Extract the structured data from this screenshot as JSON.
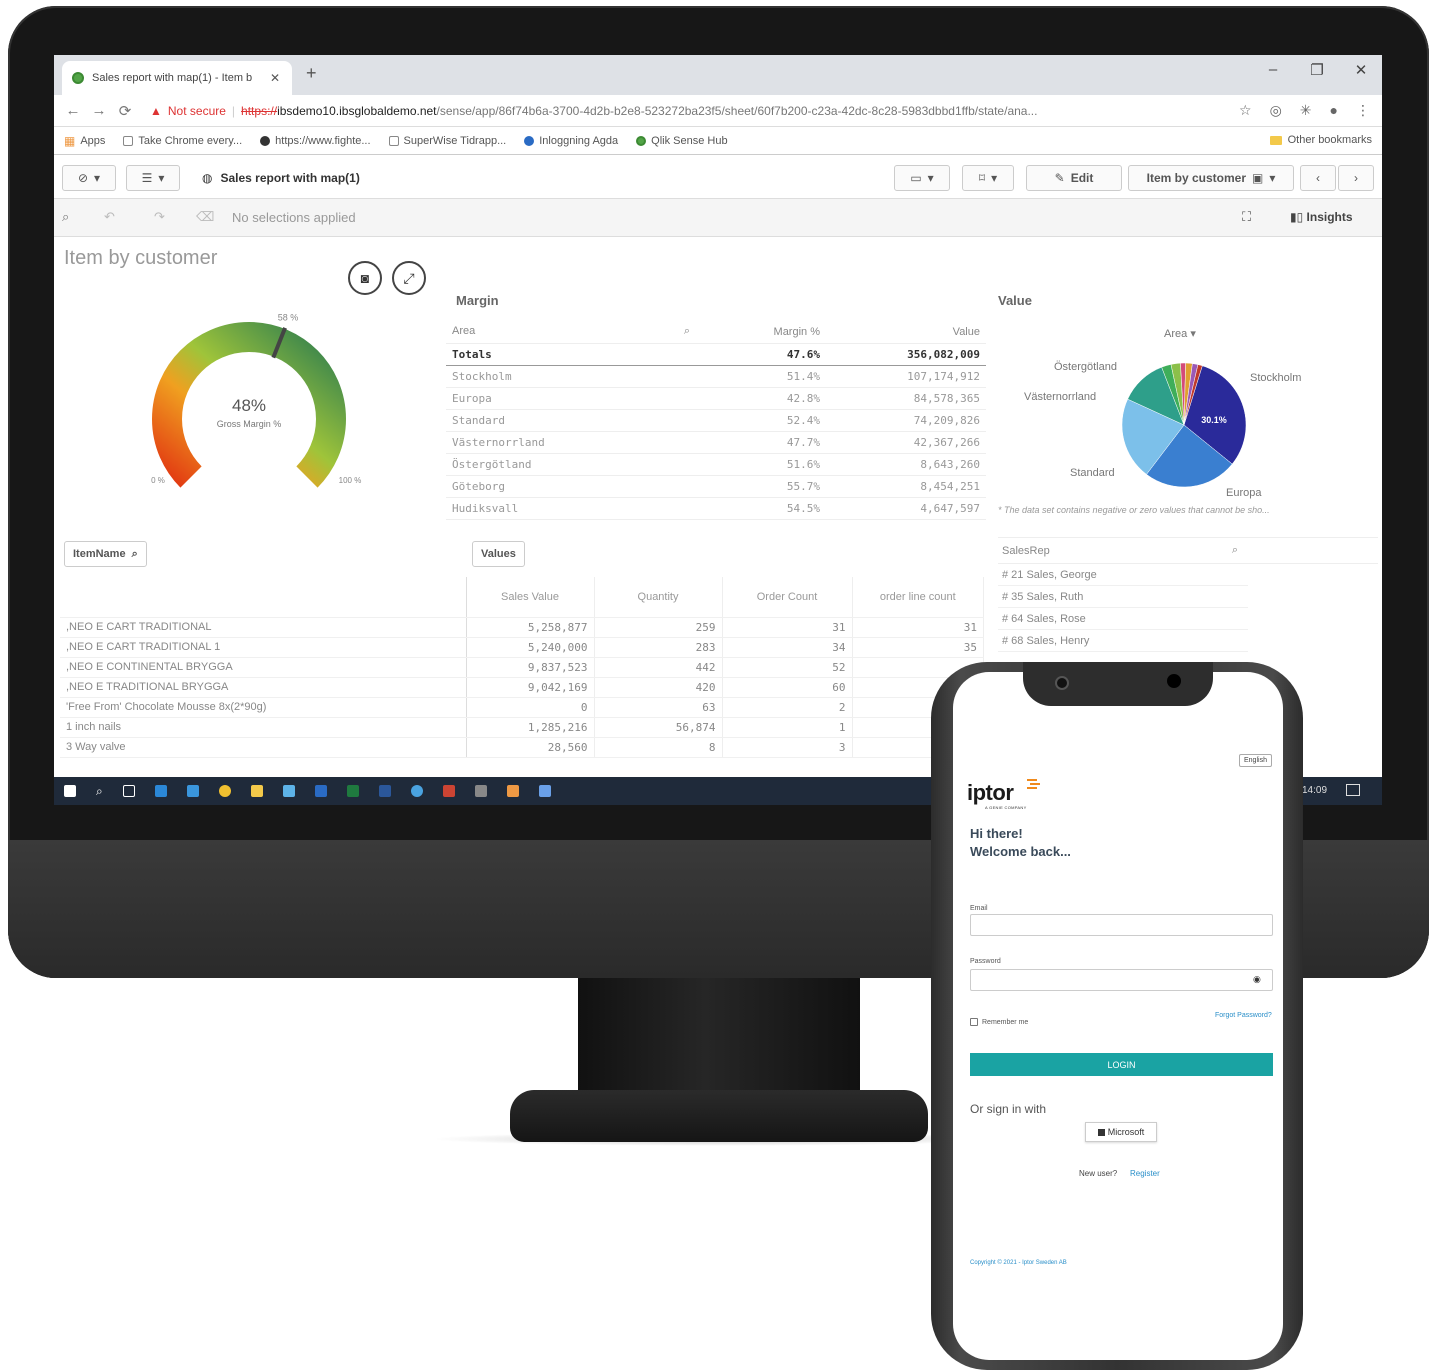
{
  "browser": {
    "tab_title": "Sales report with map(1) - Item b",
    "tab_close": "✕",
    "new_tab": "+",
    "win_minimize": "–",
    "win_maximize": "❐",
    "win_close": "✕",
    "not_secure": "Not secure",
    "url_scheme": "https://",
    "url_host": "ibsdemo10.ibsglobaldemo.net",
    "url_path": "/sense/app/86f74b6a-3700-4d2b-b2e8-523272ba23f5/sheet/60f7b200-c23a-42dc-8c28-5983dbbd1ffb/state/ana...",
    "bookmarks": [
      "Apps",
      "Take Chrome every...",
      "https://www.fighte...",
      "SuperWise Tidrapp...",
      "Inloggning Agda",
      "Qlik Sense Hub"
    ],
    "other_bookmarks": "Other bookmarks"
  },
  "qlik": {
    "app_title": "Sales report with map(1)",
    "edit_label": "Edit",
    "sheet_selector": "Item by customer",
    "selections_text": "No selections applied",
    "insights_label": "Insights",
    "sheet_title": "Item by customer",
    "gauge": {
      "value": "48%",
      "label": "Gross Margin %",
      "min_label": "0 %",
      "max_label": "100 %",
      "target_label": "58 %",
      "fraction": 0.48,
      "target_fraction": 0.58
    },
    "margin_table": {
      "title": "Margin",
      "headers": [
        "Area",
        "Margin %",
        "Value"
      ],
      "totals": [
        "Totals",
        "47.6%",
        "356,082,009"
      ],
      "rows": [
        [
          "Stockholm",
          "51.4%",
          "107,174,912"
        ],
        [
          "Europa",
          "42.8%",
          "84,578,365"
        ],
        [
          "Standard",
          "52.4%",
          "74,209,826"
        ],
        [
          "Västernorrland",
          "47.7%",
          "42,367,266"
        ],
        [
          "Östergötland",
          "51.6%",
          "8,643,260"
        ],
        [
          "Göteborg",
          "55.7%",
          "8,454,251"
        ],
        [
          "Hudiksvall",
          "54.5%",
          "4,647,597"
        ]
      ]
    },
    "value_chart": {
      "title": "Value",
      "dimension_label": "Area",
      "slice_label": "30.1%",
      "labels": [
        "Östergötland",
        "Stockholm",
        "Västernorrland",
        "Standard",
        "Europa"
      ],
      "footnote": "* The data set contains negative or zero values that cannot be sho..."
    },
    "item_filter": {
      "label": "ItemName"
    },
    "values_table": {
      "label": "Values",
      "headers": [
        "Sales Value",
        "Quantity",
        "Order Count",
        "order line count"
      ],
      "rows": [
        [
          ",NEO E CART TRADITIONAL",
          "5,258,877",
          "259",
          "31",
          "31"
        ],
        [
          ",NEO E CART TRADITIONAL 1",
          "5,240,000",
          "283",
          "34",
          "35"
        ],
        [
          ",NEO E CONTINENTAL BRYGGA",
          "9,837,523",
          "442",
          "52",
          ""
        ],
        [
          ",NEO E TRADITIONAL BRYGGA",
          "9,042,169",
          "420",
          "60",
          ""
        ],
        [
          "'Free From' Chocolate Mousse 8x(2*90g)",
          "0",
          "63",
          "2",
          ""
        ],
        [
          "1 inch nails",
          "1,285,216",
          "56,874",
          "1",
          ""
        ],
        [
          "3 Way valve",
          "28,560",
          "8",
          "3",
          ""
        ]
      ]
    },
    "salesrep": {
      "header": "SalesRep",
      "items": [
        "# 21 Sales, George",
        "# 35 Sales, Ruth",
        "# 64 Sales, Rose",
        "# 68 Sales, Henry"
      ]
    },
    "taskbar_time": "14:09"
  },
  "login": {
    "language_button": "English",
    "logo_text": "iptor",
    "logo_subtext": "A GENIE COMPANY",
    "greeting_line1": "Hi there!",
    "greeting_line2": "Welcome back...",
    "email_label": "Email",
    "password_label": "Password",
    "remember_label": "Remember me",
    "forgot_link": "Forgot Password?",
    "login_button": "LOGIN",
    "or_sign_in": "Or sign in with",
    "microsoft_button": "Microsoft",
    "new_user_text": "New user?",
    "register_link": "Register",
    "copyright": "Copyright © 2021 - Iptor Sweden AB",
    "accent": "#1aa3a3"
  }
}
